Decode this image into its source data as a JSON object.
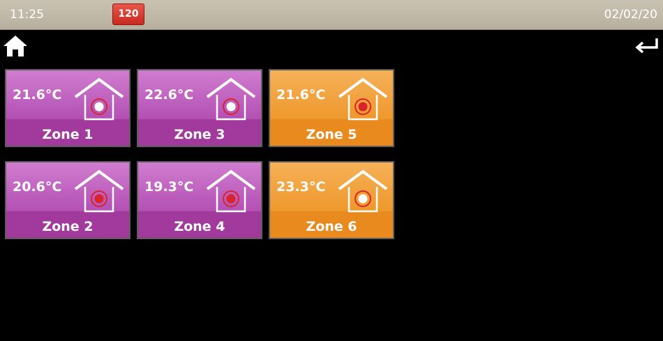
{
  "status_bar": {
    "time": "11:25",
    "date": "02/02/20",
    "alert_count": "120",
    "alert_color": "#d83a2f"
  },
  "nav": {
    "home_icon": "home-icon",
    "back_icon": "return-arrow-icon"
  },
  "zones": [
    {
      "id": "zone-1",
      "label": "Zone 1",
      "temperature": "21.6°C",
      "color": "purple",
      "indicator": "white-dot"
    },
    {
      "id": "zone-3",
      "label": "Zone 3",
      "temperature": "22.6°C",
      "color": "purple",
      "indicator": "white-dot"
    },
    {
      "id": "zone-5",
      "label": "Zone 5",
      "temperature": "21.6°C",
      "color": "orange",
      "indicator": "red-dot"
    },
    {
      "id": "zone-2",
      "label": "Zone 2",
      "temperature": "20.6°C",
      "color": "purple",
      "indicator": "red-dot"
    },
    {
      "id": "zone-4",
      "label": "Zone 4",
      "temperature": "19.3°C",
      "color": "purple",
      "indicator": "red-dot"
    },
    {
      "id": "zone-6",
      "label": "Zone 6",
      "temperature": "23.3°C",
      "color": "orange",
      "indicator": "white-dot"
    }
  ],
  "colors": {
    "purple": "#b553b6",
    "orange": "#ee9a2f",
    "indicator_ring": "#d8242a"
  }
}
